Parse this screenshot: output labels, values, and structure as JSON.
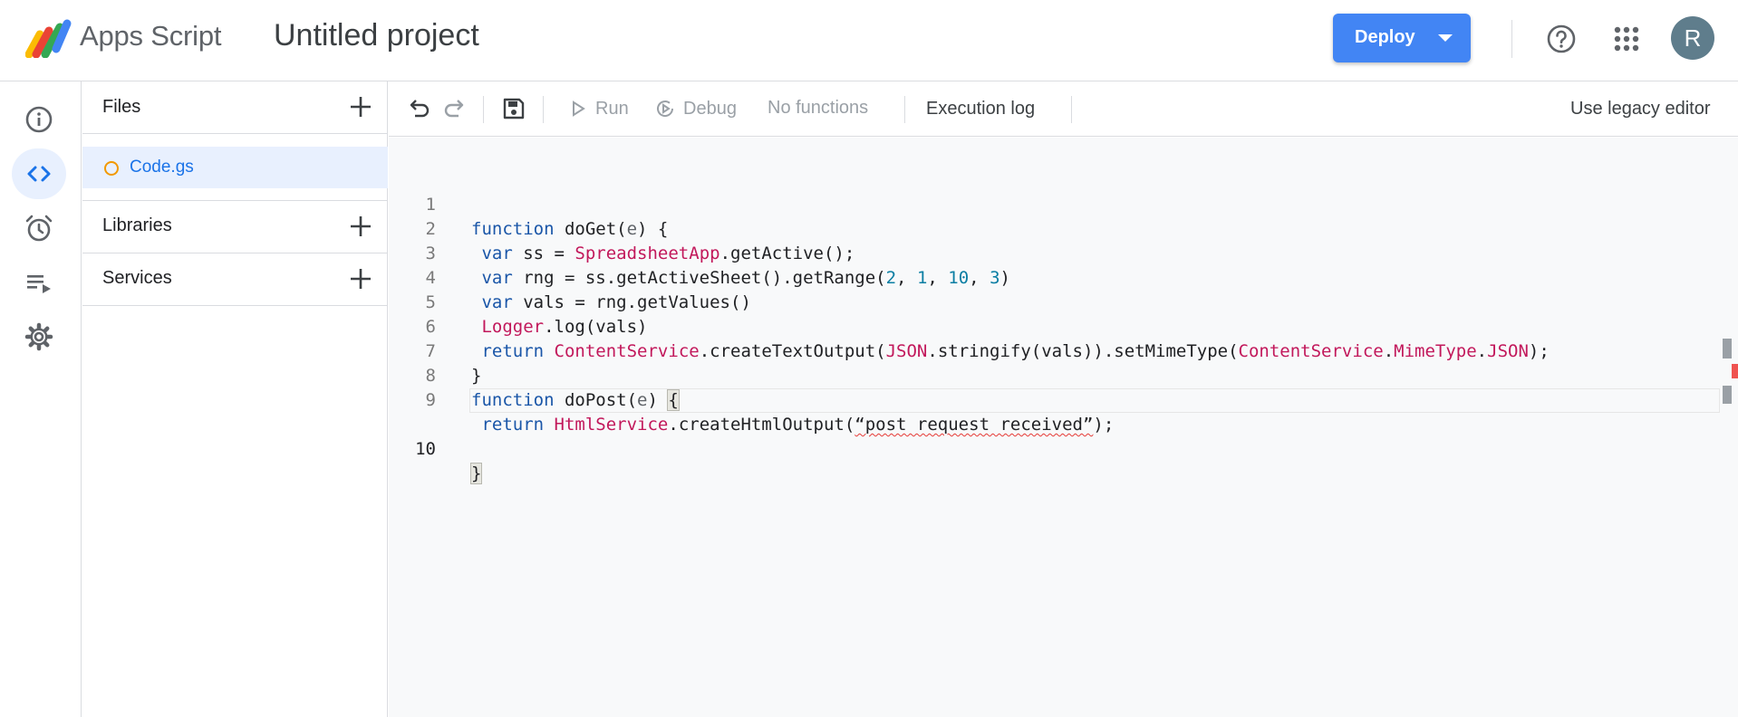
{
  "header": {
    "brand": "Apps Script",
    "project_title": "Untitled project",
    "deploy_label": "Deploy",
    "avatar_initial": "R"
  },
  "files_panel": {
    "files_title": "Files",
    "files": [
      {
        "name": "Code.gs"
      }
    ],
    "libraries_title": "Libraries",
    "services_title": "Services"
  },
  "toolbar": {
    "run_label": "Run",
    "debug_label": "Debug",
    "function_select": "No functions",
    "execution_log_label": "Execution log",
    "legacy_label": "Use legacy editor"
  },
  "editor": {
    "line_numbers": [
      "1",
      "2",
      "3",
      "4",
      "5",
      "6",
      "7",
      "8",
      "9",
      "10"
    ],
    "code_lines": [
      "function doGet(e) {",
      " var ss = SpreadsheetApp.getActive();",
      " var rng = ss.getActiveSheet().getRange(2, 1, 10, 3)",
      " var vals = rng.getValues()",
      " Logger.log(vals)",
      " return ContentService.createTextOutput(JSON.stringify(vals)).setMimeType(ContentService.MimeType.JSON);",
      "}",
      "function doPost(e) {",
      " return HtmlService.createHtmlOutput(“post request received”);",
      "}"
    ]
  },
  "icons": {
    "nav": [
      "info-icon",
      "code-icon",
      "alarm-clock-icon",
      "executions-icon",
      "gear-icon"
    ],
    "toolbar": [
      "undo-icon",
      "redo-icon",
      "save-icon",
      "play-icon",
      "debug-icon"
    ]
  },
  "colors": {
    "accent": "#4285f4",
    "selected_bg": "#e8f0fe",
    "link": "#1a73e8",
    "keyword": "#1a56a8",
    "class_name": "#c2185b",
    "number": "#0b7ea3",
    "error": "#ef5350"
  }
}
